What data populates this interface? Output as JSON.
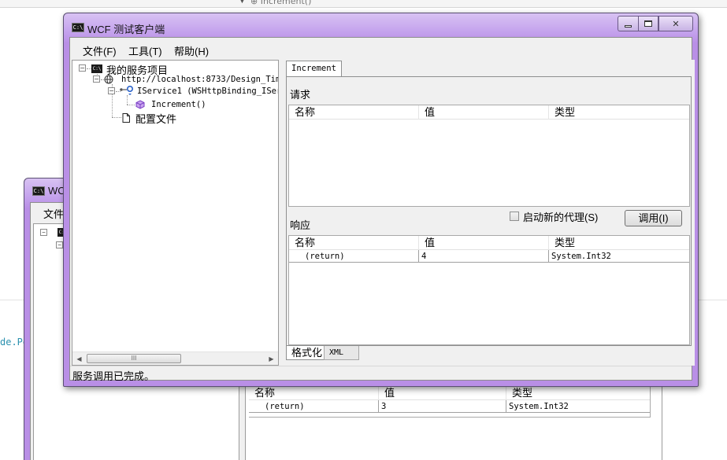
{
  "ide": {
    "member_dropdown": "Increment()",
    "code_fragment": "de.Pe"
  },
  "back_window": {
    "title": "WCF",
    "menu_file": "文件(",
    "grid": {
      "headers": [
        "名称",
        "值",
        "类型"
      ],
      "row": [
        "(return)",
        "3",
        "System.Int32"
      ]
    }
  },
  "main_window": {
    "icon_label": "C:\\",
    "title": "WCF 测试客户端",
    "menu": [
      "文件(F)",
      "工具(T)",
      "帮助(H)"
    ],
    "tree": {
      "root": "我的服务项目",
      "endpoint": "http://localhost:8733/Design_Time",
      "contract": "IService1 (WSHttpBinding_IServ",
      "operation": "Increment()",
      "config": "配置文件",
      "scroll_thumb": "III"
    },
    "tab": "Increment",
    "request": {
      "label": "请求",
      "headers": [
        "名称",
        "值",
        "类型"
      ]
    },
    "response": {
      "label": "响应",
      "new_proxy_label": "启动新的代理(S)",
      "new_proxy_checked": false,
      "invoke_label": "调用(I)",
      "headers": [
        "名称",
        "值",
        "类型"
      ],
      "row": [
        "(return)",
        "4",
        "System.Int32"
      ]
    },
    "view_tabs": [
      "格式化",
      "XML"
    ],
    "status": "服务调用已完成。"
  }
}
